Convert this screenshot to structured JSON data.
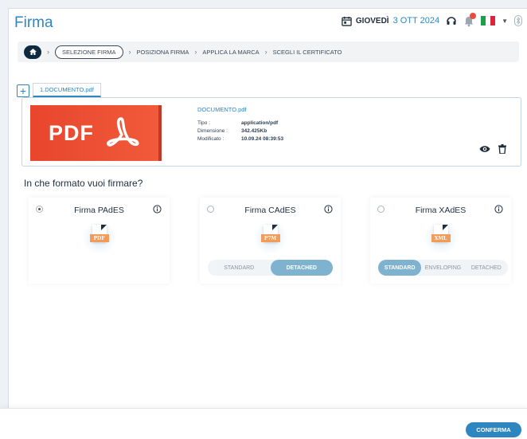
{
  "app": {
    "title": "Firma"
  },
  "header": {
    "date_day": "GIOVEDÌ",
    "date_rest": "3 OTT 2024",
    "calendar_icon": "calendar-icon",
    "flag": "italy-flag",
    "colors": {
      "accent": "#2e86c1",
      "dark": "#0f2a3f",
      "notification": "#e74c3c"
    }
  },
  "breadcrumb": {
    "steps": [
      "SELEZIONE FIRMA",
      "POSIZIONA FIRMA",
      "APPLICA LA MARCA",
      "SCEGLI IL CERTIFICATO"
    ]
  },
  "tabs": {
    "add_label": "+",
    "document_tab": "1.DOCUMENTO.pdf"
  },
  "document": {
    "banner_text": "PDF",
    "name": "DOCUMENTO.pdf",
    "meta": [
      {
        "key": "Tipo :",
        "value": "application/pdf"
      },
      {
        "key": "Dimensione :",
        "value": "342.425Kb"
      },
      {
        "key": "Modificato :",
        "value": "10.09.24 08:39:53"
      }
    ]
  },
  "formats": {
    "question": "In che formato vuoi firmare?",
    "cards": [
      {
        "title": "Firma PAdES",
        "badge": "PDF",
        "selected": true,
        "options": []
      },
      {
        "title": "Firma CAdES",
        "badge": "P7M",
        "selected": false,
        "options": [
          {
            "label": "STANDARD",
            "active": false
          },
          {
            "label": "DETACHED",
            "active": true
          }
        ]
      },
      {
        "title": "Firma XAdES",
        "badge": "XML",
        "selected": false,
        "options": [
          {
            "label": "STANDARD",
            "active": true
          },
          {
            "label": "ENVELOPING",
            "active": false
          },
          {
            "label": "DETACHED",
            "active": false
          }
        ]
      }
    ]
  },
  "footer": {
    "confirm_label": "CONFERMA"
  }
}
